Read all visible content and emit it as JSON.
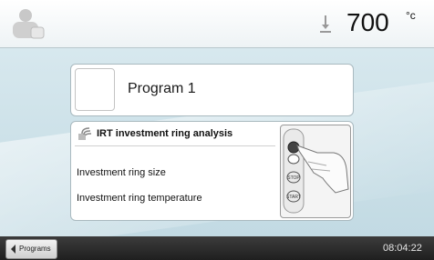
{
  "header": {
    "temperature": "700",
    "temperature_unit": "°c"
  },
  "program": {
    "name": "Program 1"
  },
  "irt": {
    "title": "IRT investment ring analysis",
    "rows": [
      "Investment ring size",
      "Investment ring temperature"
    ],
    "illustration_buttons": [
      "STOP",
      "START"
    ]
  },
  "footer": {
    "back_label": "Programs",
    "clock": "08:04:22"
  },
  "colors": {
    "accent_bg": "#cfe3ea",
    "footer_bg": "#2a2a2a"
  },
  "icons": {
    "user": "user-profile-icon",
    "down": "arrow-down-icon",
    "irt": "irt-sensor-icon",
    "back": "chevron-left-icon"
  }
}
